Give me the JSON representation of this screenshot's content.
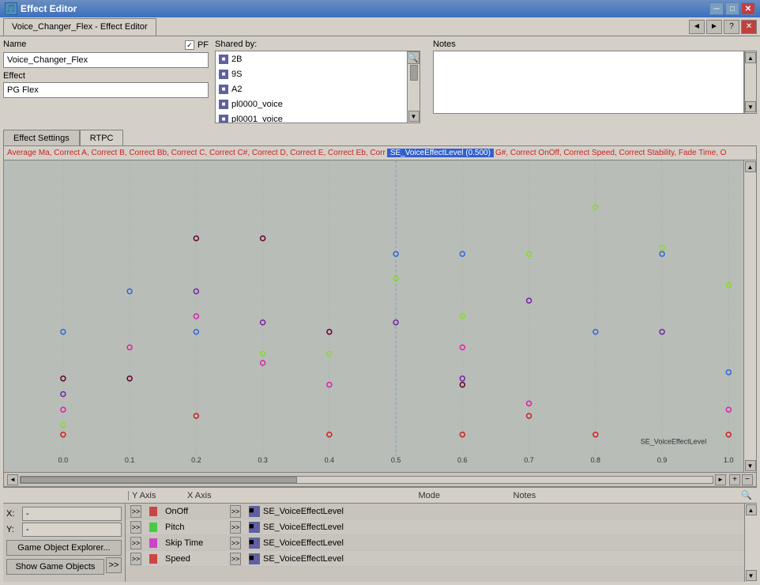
{
  "window": {
    "title": "Effect Editor",
    "icon": "🎵"
  },
  "top_tab": {
    "label": "Voice_Changer_Flex - Effect Editor"
  },
  "top_controls": [
    "◄►",
    "?",
    "✕"
  ],
  "name_section": {
    "label": "Name",
    "value": "Voice_Changer_Flex",
    "pf_label": "PF",
    "effect_label": "Effect",
    "effect_value": "PG Flex"
  },
  "shared_by": {
    "label": "Shared by:",
    "items": [
      {
        "icon": "■",
        "text": "2B"
      },
      {
        "icon": "■",
        "text": "9S"
      },
      {
        "icon": "■",
        "text": "A2"
      },
      {
        "icon": "■",
        "text": "pl0000_voice"
      },
      {
        "icon": "■",
        "text": "pl0001_voice"
      }
    ]
  },
  "notes": {
    "label": "Notes",
    "value": ""
  },
  "tabs": {
    "effect_settings": "Effect Settings",
    "rtpc": "RTPC"
  },
  "graph": {
    "header_text": "Average Ma,  Correct A,  Correct B,  Correct Bb,  Correct C,  Correct C#,  Correct D,  Correct E,  Correct Eb,  Corr",
    "highlight_label": "SE_VoiceEffectLevel (0.500)",
    "header_after": "G#,  Correct OnOff,  Correct Speed,  Correct Stability,  Fade Time, O",
    "x_label": "SE_VoiceEffectLevel",
    "x_axis": [
      "0.0",
      "0.1",
      "0.2",
      "0.3",
      "0.4",
      "0.5",
      "0.6",
      "0.7",
      "0.8",
      "0.9",
      "1.0"
    ]
  },
  "bottom": {
    "columns": {
      "y_axis": "Y Axis",
      "x_axis": "X Axis",
      "mode": "Mode",
      "notes": "Notes"
    },
    "coords": {
      "x_label": "X:",
      "x_value": "-",
      "y_label": "Y:",
      "y_value": "-"
    },
    "game_obj_btn": "Game Object Explorer...",
    "show_game_btn": "Show Game Objects",
    "rows": [
      {
        "color": "#cc4444",
        "y_axis": "OnOff",
        "x_axis": "SE_VoiceEffectLevel",
        "mode": "",
        "notes": ""
      },
      {
        "color": "#44cc44",
        "y_axis": "Pitch",
        "x_axis": "SE_VoiceEffectLevel",
        "mode": "",
        "notes": ""
      },
      {
        "color": "#cc44cc",
        "y_axis": "Skip Time",
        "x_axis": "SE_VoiceEffectLevel",
        "mode": "",
        "notes": ""
      },
      {
        "color": "#cc4444",
        "y_axis": "Speed",
        "x_axis": "SE_VoiceEffectLevel",
        "mode": "",
        "notes": ""
      }
    ]
  },
  "search_icon": "🔍",
  "arrow_right": ">>",
  "icons": {
    "minimize": "─",
    "maximize": "□",
    "close": "✕",
    "scroll_up": "▲",
    "scroll_down": "▼",
    "scroll_left": "◄",
    "scroll_right": "►",
    "plus": "+",
    "minus": "−"
  }
}
